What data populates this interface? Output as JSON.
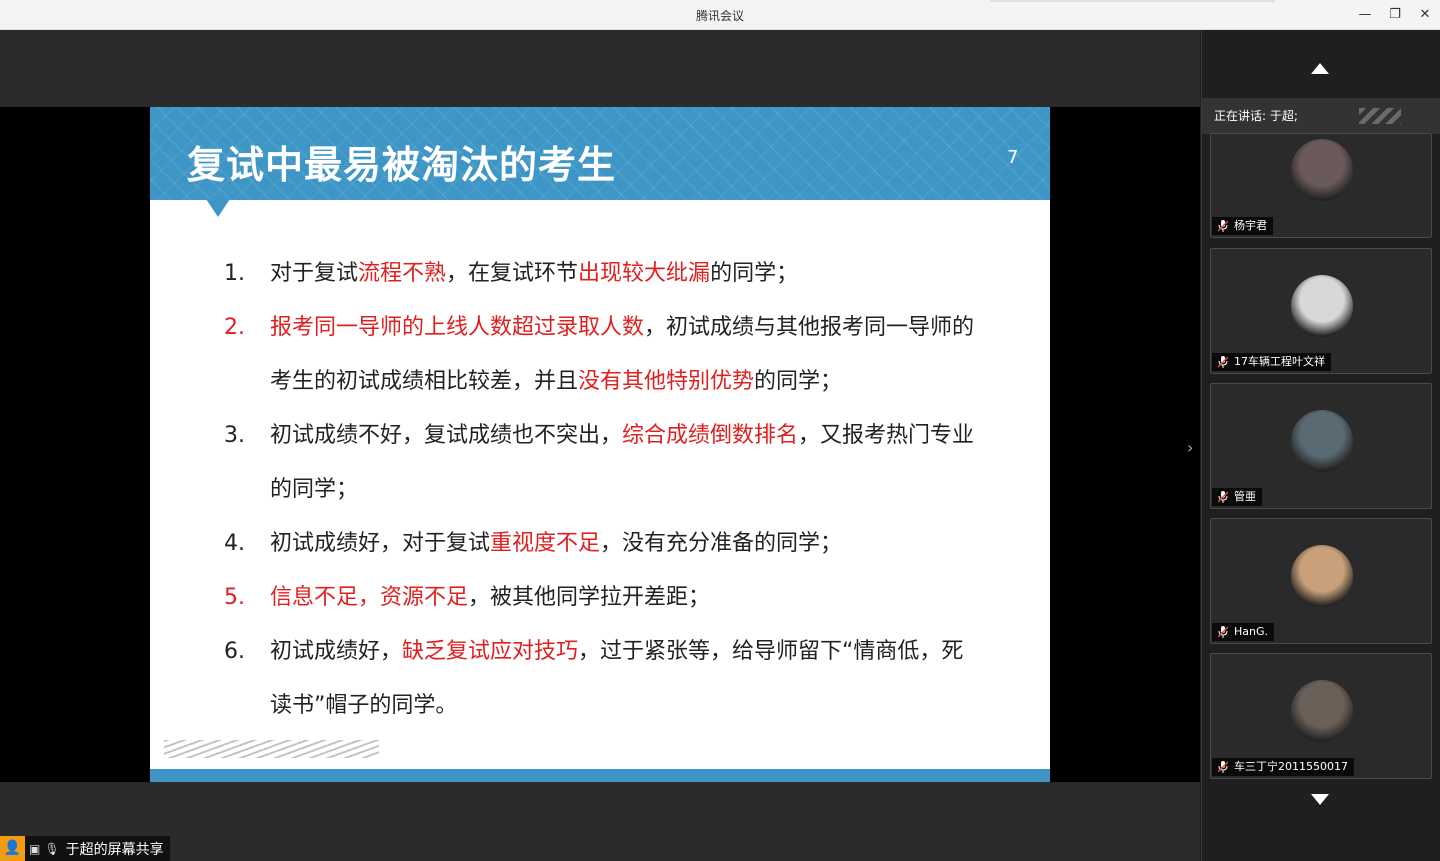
{
  "window": {
    "title": "腾讯会议"
  },
  "slide": {
    "title": "复试中最易被淘汰的考生",
    "page_number": "7",
    "items": [
      {
        "num": "1.",
        "num_red": false,
        "segments": [
          {
            "t": "对于复试",
            "r": false
          },
          {
            "t": "流程不熟",
            "r": true
          },
          {
            "t": "，在复试环节",
            "r": false
          },
          {
            "t": "出现较大纰漏",
            "r": true
          },
          {
            "t": "的同学；",
            "r": false
          }
        ]
      },
      {
        "num": "2.",
        "num_red": true,
        "segments": [
          {
            "t": "报考同一导师的上线人数超过录取人数",
            "r": true
          },
          {
            "t": "，初试成绩与其他报考同一导师的考生的初试成绩相比较差，并且",
            "r": false
          },
          {
            "t": "没有其他特别优势",
            "r": true
          },
          {
            "t": "的同学；",
            "r": false
          }
        ]
      },
      {
        "num": "3.",
        "num_red": false,
        "segments": [
          {
            "t": "初试成绩不好，复试成绩也不突出，",
            "r": false
          },
          {
            "t": "综合成绩倒数排名",
            "r": true
          },
          {
            "t": "，又报考热门专业的同学；",
            "r": false
          }
        ]
      },
      {
        "num": "4.",
        "num_red": false,
        "segments": [
          {
            "t": "初试成绩好，对于复试",
            "r": false
          },
          {
            "t": "重视度不足",
            "r": true
          },
          {
            "t": "，没有充分准备的同学；",
            "r": false
          }
        ]
      },
      {
        "num": "5.",
        "num_red": true,
        "segments": [
          {
            "t": "信息不足，资源不足",
            "r": true
          },
          {
            "t": "，被其他同学拉开差距；",
            "r": false
          }
        ]
      },
      {
        "num": "6.",
        "num_red": false,
        "segments": [
          {
            "t": "初试成绩好，",
            "r": false
          },
          {
            "t": "缺乏复试应对技巧",
            "r": true
          },
          {
            "t": "，过于紧张等，给导师留下“情商低，死读书”帽子的同学。",
            "r": false
          }
        ]
      }
    ]
  },
  "sidebar": {
    "speaking_label": "正在讲话: 于超;",
    "participants": [
      {
        "name": "杨宇君",
        "avatar_color": "#6b5a5a"
      },
      {
        "name": "17车辆工程叶文祥",
        "avatar_color": "#d8d8d8"
      },
      {
        "name": "管亜",
        "avatar_color": "#5a6a72"
      },
      {
        "name": "HanG.",
        "avatar_color": "#c9a07a"
      },
      {
        "name": "车三丁宁2011550017",
        "avatar_color": "#6a6058"
      }
    ]
  },
  "share": {
    "label": "于超的屏幕共享"
  },
  "colors": {
    "accent": "#3d96c6",
    "highlight": "#e02020"
  }
}
